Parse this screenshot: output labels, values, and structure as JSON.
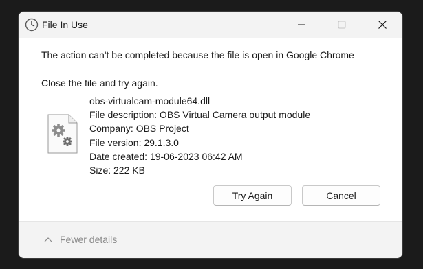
{
  "window": {
    "title": "File In Use"
  },
  "message": "The action can't be completed because the file is open in Google Chrome",
  "instruction": "Close the file and try again.",
  "file": {
    "name": "obs-virtualcam-module64.dll",
    "description": "File description: OBS Virtual Camera output module",
    "company": "Company: OBS Project",
    "version": "File version: 29.1.3.0",
    "created": "Date created: 19-06-2023 06:42 AM",
    "size": "Size: 222 KB"
  },
  "buttons": {
    "try_again": "Try Again",
    "cancel": "Cancel"
  },
  "footer": {
    "toggle_label": "Fewer details"
  },
  "icons": {
    "title": "clock-icon",
    "file": "dll-file-gears-icon",
    "toggle": "chevron-up-icon"
  }
}
